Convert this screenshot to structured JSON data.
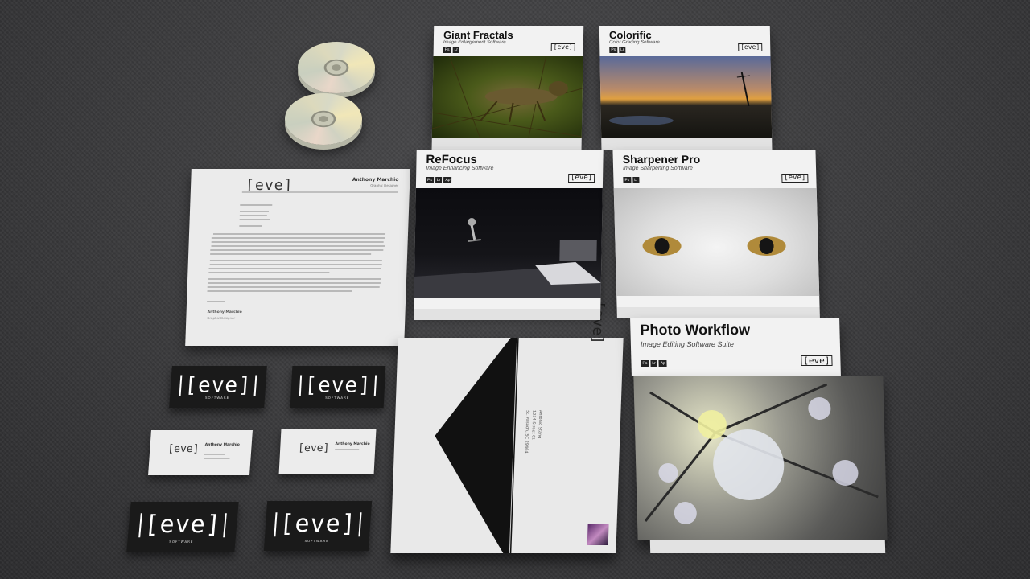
{
  "brand": {
    "logo_text": "[eve]",
    "tagline": "SOFTWARE"
  },
  "letterhead": {
    "sender_name": "Anthony Marchio",
    "sender_role": "Graphic Designer",
    "signature_name": "Anthony Marchio",
    "signature_role": "Graphic Designer"
  },
  "business_card_light": {
    "name": "Anthony Marchio"
  },
  "envelope": {
    "address_lines": [
      "Antonio Stang",
      "1234 Street Ct",
      "St. Pasadn, SC 29464"
    ]
  },
  "products": [
    {
      "title": "Giant Fractals",
      "subtitle": "Image Enlargement Software",
      "badges": [
        "Ps",
        "Lr"
      ]
    },
    {
      "title": "Colorific",
      "subtitle": "Color Grading Software",
      "badges": [
        "Ps",
        "Lr"
      ]
    },
    {
      "title": "ReFocus",
      "subtitle": "Image Enhancing Software",
      "badges": [
        "Ps",
        "Lr",
        "Ap"
      ]
    },
    {
      "title": "Sharpener Pro",
      "subtitle": "Image Sharpening Software",
      "badges": [
        "Ps",
        "Lr"
      ]
    },
    {
      "title": "Photo Workflow",
      "subtitle": "Image Editing Software Suite",
      "badges": [
        "Ps",
        "Lr",
        "Ap"
      ]
    }
  ],
  "colors": {
    "carpet": "#3a3a3c",
    "paper": "#ebebeb",
    "card_dark": "#1a1a1a"
  }
}
